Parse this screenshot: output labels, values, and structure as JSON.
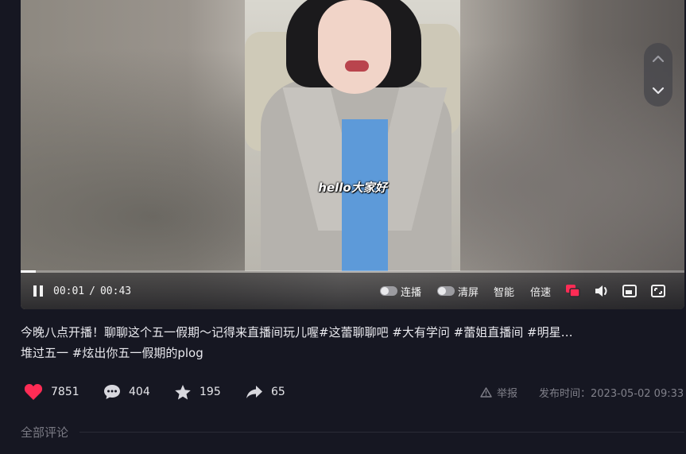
{
  "player": {
    "subtitle": "hello大家好",
    "current_time": "00:01",
    "separator": "/",
    "duration": "00:43",
    "progress_fraction": 0.023,
    "autoplay_label": "连播",
    "clear_screen_label": "清屏",
    "smart_label": "智能",
    "speed_label": "倍速",
    "icons": {
      "pause": "pause-icon",
      "prev_video": "chevron-up-icon",
      "next_video": "chevron-down-icon",
      "danmaku": "danmaku-icon",
      "volume": "volume-icon",
      "pip": "picture-in-picture-icon",
      "fullscreen": "fullscreen-icon"
    },
    "accent_color": "#fe2c55"
  },
  "description": {
    "line1": "今晚八点开播！聊聊这个五一假期～记得来直播间玩儿喔#这蕾聊聊吧 #大有学问 #蕾姐直播间 #明星…",
    "line2": "堆过五一 #炫出你五一假期的plog"
  },
  "stats": {
    "likes": "7851",
    "comments": "404",
    "favorites": "195",
    "shares": "65",
    "like_color": "#fe2c55"
  },
  "report_label": "举报",
  "publish_time": "发布时间：2023-05-02 09:33",
  "comments_section": {
    "title": "全部评论"
  }
}
